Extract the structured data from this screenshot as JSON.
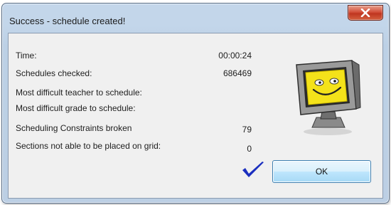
{
  "window": {
    "title": "Success - schedule created!"
  },
  "stats": {
    "time_label": "Time:",
    "time_value": "00:00:24",
    "schedules_checked_label": "Schedules checked:",
    "schedules_checked_value": "686469",
    "difficult_teacher_label": "Most difficult teacher to schedule:",
    "difficult_grade_label": "Most difficult grade to schedule:",
    "constraints_broken_label": "Scheduling Constraints broken",
    "constraints_broken_value": "79",
    "sections_unplaced_label": "Sections not able to be placed on grid:",
    "sections_unplaced_value": "0"
  },
  "buttons": {
    "ok_label": "OK"
  },
  "icons": {
    "close": "close-icon",
    "monitor": "smiling-monitor-icon",
    "check": "checkmark-icon"
  },
  "colors": {
    "close_red": "#c8412a",
    "ok_blue": "#bee6fd",
    "check_blue": "#1b2fbf",
    "monitor_face": "#f4e21a"
  }
}
